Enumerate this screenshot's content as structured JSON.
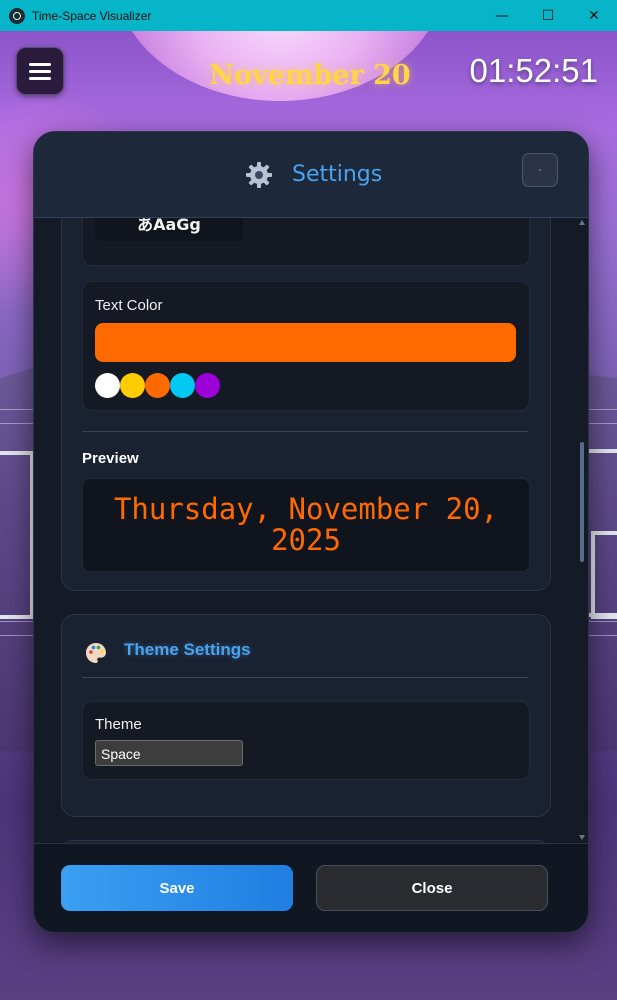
{
  "window": {
    "title": "Time-Space Visualizer",
    "controls": {
      "minimize": "—",
      "maximize": "☐",
      "close": "✕"
    }
  },
  "hud": {
    "date": "November 20",
    "time": "01:52:51",
    "menu_icon": "hamburger-icon"
  },
  "settings": {
    "title": "Settings",
    "title_icon": "gear-icon",
    "font_sample": "あAaGg",
    "text_color": {
      "label": "Text Color",
      "selected": "#ff6a00",
      "swatches": [
        "#ffffff",
        "#ffcc00",
        "#ff6a00",
        "#00c8f0",
        "#9b00d8"
      ]
    },
    "preview": {
      "label": "Preview",
      "text": "Thursday, November 20, 2025"
    },
    "theme_section": {
      "title": "Theme Settings",
      "icon": "palette-icon",
      "theme_label": "Theme",
      "theme_value": "Space"
    },
    "footer": {
      "save_label": "Save",
      "close_label": "Close"
    }
  },
  "colors": {
    "accent": "#4aa3ee",
    "hud_date": "#ffd447",
    "titlebar": "#06b6c8"
  }
}
